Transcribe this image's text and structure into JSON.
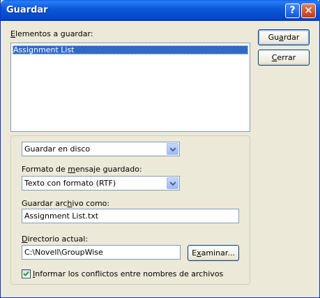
{
  "window": {
    "title": "Guardar",
    "help_glyph": "?",
    "close_glyph": "✕",
    "colors": {
      "titlebar": "#0a5ad8",
      "selection": "#316ac5",
      "face": "#ece9d8"
    }
  },
  "items_list": {
    "label_pre": "",
    "label_key": "E",
    "label_post": "lementos a guardar:",
    "items": [
      "Assignment List"
    ]
  },
  "buttons": {
    "save": {
      "pre": "Gu",
      "key": "a",
      "post": "rdar"
    },
    "close": {
      "pre": "",
      "key": "C",
      "post": "errar"
    }
  },
  "destination": {
    "value": "Guardar en disco"
  },
  "format": {
    "label_pre": "Formato de ",
    "label_key": "m",
    "label_post": "ensaje guardado:",
    "value": "Texto con formato (RTF)"
  },
  "save_as": {
    "label_pre": "Guardar arc",
    "label_key": "h",
    "label_post": "ivo como:",
    "value": "Assignment List.txt"
  },
  "current_dir": {
    "label_pre": "",
    "label_key": "D",
    "label_post": "irectorio actual:",
    "value": "C:\\Novell\\GroupWise"
  },
  "browse_button": {
    "pre": "E",
    "key": "x",
    "post": "aminar..."
  },
  "conflicts_check": {
    "checked": true,
    "pre": "",
    "key": "I",
    "post": "nformar los conflictos entre nombres de archivos"
  },
  "icons": {
    "dropdown": "chevron-down-icon",
    "check": "checkmark-icon"
  }
}
